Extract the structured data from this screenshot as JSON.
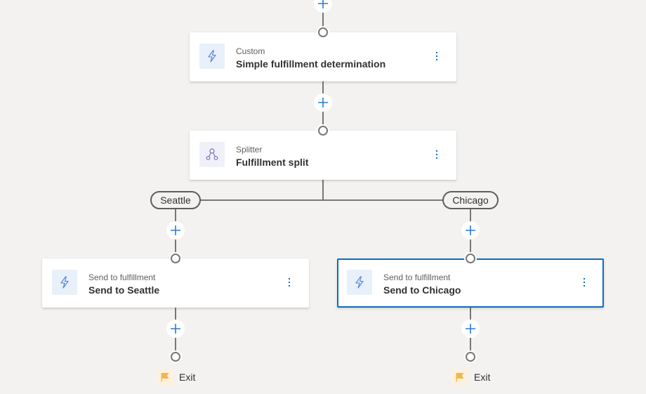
{
  "colors": {
    "canvas_bg": "#f3f2f1",
    "connector": "#797775",
    "accent": "#0f6cbd",
    "add_icon": "#2b7cd3",
    "exit_flag": "#f2b84b"
  },
  "nodes": [
    {
      "id": "custom",
      "type_label": "Custom",
      "title": "Simple fulfillment determination",
      "icon": "lightning-bolt-icon",
      "selected": false
    },
    {
      "id": "splitter",
      "type_label": "Splitter",
      "title": "Fulfillment split",
      "icon": "splitter-icon",
      "selected": false
    },
    {
      "id": "send-seattle",
      "type_label": "Send to fulfillment",
      "title": "Send to Seattle",
      "icon": "lightning-bolt-icon",
      "selected": false
    },
    {
      "id": "send-chicago",
      "type_label": "Send to fulfillment",
      "title": "Send to Chicago",
      "icon": "lightning-bolt-icon",
      "selected": true
    }
  ],
  "branches": [
    {
      "label": "Seattle"
    },
    {
      "label": "Chicago"
    }
  ],
  "exits": [
    {
      "label": "Exit",
      "icon": "flag-icon"
    },
    {
      "label": "Exit",
      "icon": "flag-icon"
    }
  ],
  "more_options_icon": "more-vertical-icon",
  "add_step_icon": "plus-icon"
}
